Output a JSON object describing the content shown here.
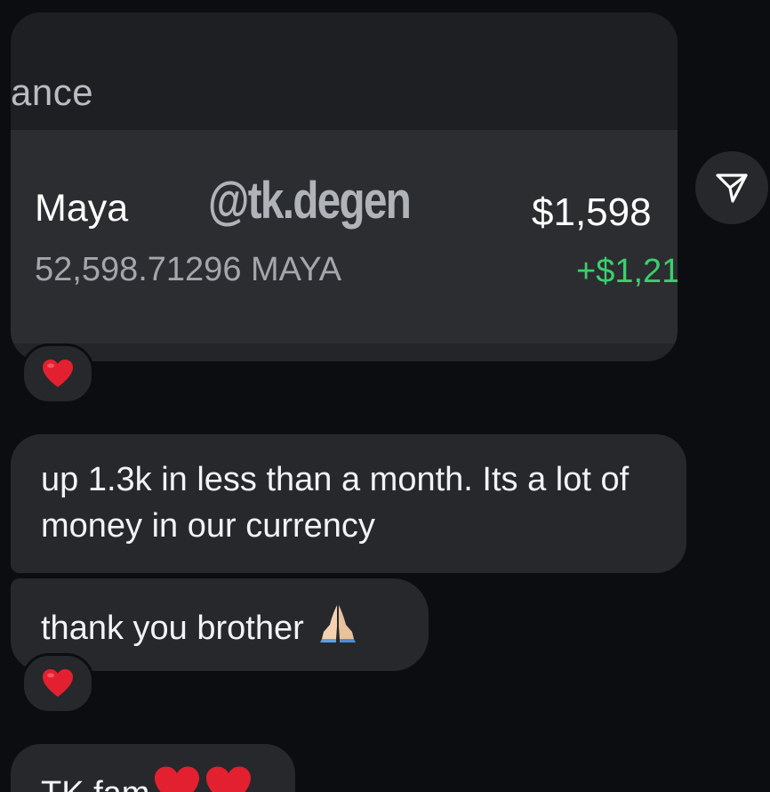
{
  "shared_card": {
    "header_fragment": "ance",
    "token_name": "Maya",
    "watermark": "@tk.degen",
    "value": "$1,598",
    "amount": "52,598.71296 MAYA",
    "change": "+$1,21",
    "change_color": "#3ccf6d"
  },
  "icons": {
    "share": "paper-plane-icon",
    "reaction": "red-heart-icon",
    "prayer": "folded-hands-icon"
  },
  "messages": [
    {
      "text": "up 1.3k in less than a month. Its a lot of money in our currency"
    },
    {
      "text": "thank you brother"
    },
    {
      "text": "TK fam"
    }
  ],
  "colors": {
    "background": "#0b0d10",
    "bubble": "#26282c",
    "heart": "#e3202f"
  }
}
